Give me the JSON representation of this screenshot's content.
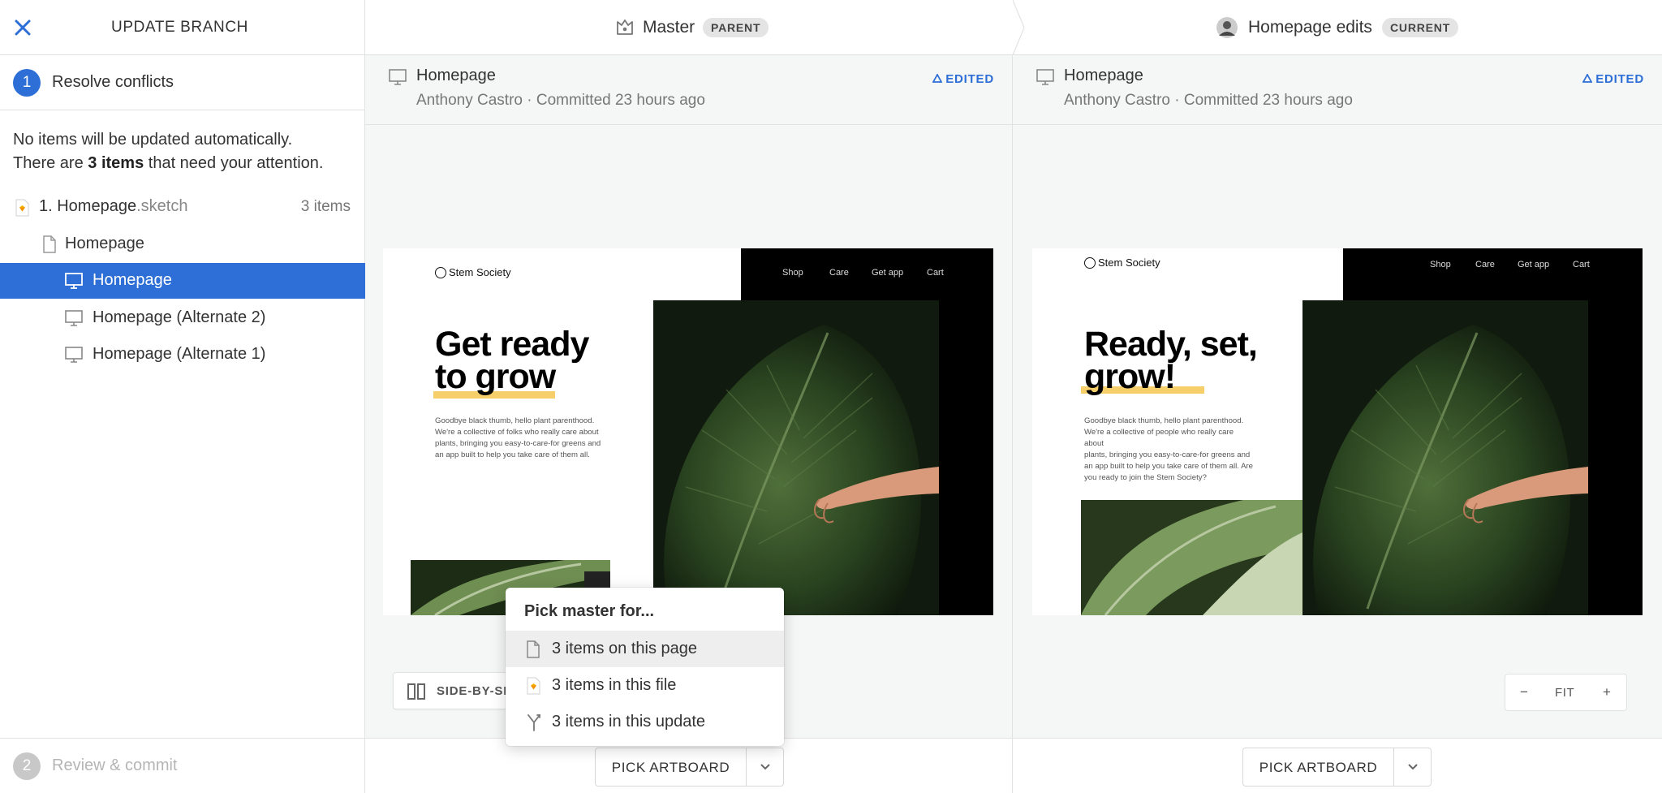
{
  "sidebar": {
    "title": "UPDATE BRANCH",
    "step1": {
      "number": "1",
      "label": "Resolve conflicts"
    },
    "info_line1": "No items will be updated automatically.",
    "info_line2_prefix": "There are ",
    "info_line2_bold": "3 items",
    "info_line2_suffix": " that need your attention.",
    "file": {
      "name": "1. Homepage",
      "ext": ".sketch",
      "count": "3 items"
    },
    "page": {
      "label": "Homepage"
    },
    "artboards": [
      {
        "label": "Homepage",
        "selected": true
      },
      {
        "label": "Homepage (Alternate 2)",
        "selected": false
      },
      {
        "label": "Homepage (Alternate 1)",
        "selected": false
      }
    ],
    "step2": {
      "number": "2",
      "label": "Review & commit"
    }
  },
  "header": {
    "left": {
      "name": "Master",
      "badge": "PARENT"
    },
    "right": {
      "name": "Homepage edits",
      "badge": "CURRENT"
    }
  },
  "left_pane": {
    "title": "Homepage",
    "meta": "Anthony Castro · Committed 23 hours ago",
    "status": "EDITED",
    "artboard": {
      "logo": "Stem Society",
      "nav": [
        "Shop",
        "Care",
        "Get app",
        "Cart"
      ],
      "headline_1": "Get ready",
      "headline_2": "to grow",
      "body": [
        "Goodbye black thumb, hello plant parenthood.",
        "We're a collective of folks who really care about",
        "plants, bringing you easy-to-care-for greens and",
        "an app built to help you take care of them all."
      ]
    },
    "view_toggle": "SIDE-BY-SIDE",
    "pick_button": "PICK ARTBOARD"
  },
  "right_pane": {
    "title": "Homepage",
    "meta": "Anthony Castro · Committed 23 hours ago",
    "status": "EDITED",
    "artboard": {
      "logo": "Stem Society",
      "nav": [
        "Shop",
        "Care",
        "Get app",
        "Cart"
      ],
      "headline_1": "Ready, set,",
      "headline_2": "grow!",
      "body": [
        "Goodbye black thumb, hello plant parenthood.",
        "We're a collective of people who really care about",
        "plants, bringing you easy-to-care-for greens and",
        "an app built to help you take care of them all. Are",
        "you ready to join the Stem Society?"
      ]
    },
    "zoom": {
      "minus": "−",
      "label": "FIT",
      "plus": "+"
    },
    "pick_button": "PICK ARTBOARD"
  },
  "popover": {
    "title": "Pick master for...",
    "items": [
      {
        "label": "3 items on this page",
        "icon": "page-icon"
      },
      {
        "label": "3 items in this file",
        "icon": "sketch-file-icon"
      },
      {
        "label": "3 items in this update",
        "icon": "merge-icon"
      }
    ]
  },
  "colors": {
    "accent": "#2d6fd6",
    "highlight": "#f6cf6b"
  }
}
